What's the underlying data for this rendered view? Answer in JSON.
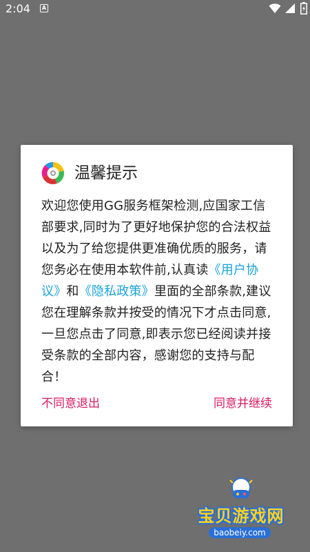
{
  "status_bar": {
    "time": "2:04",
    "notification_glyph": "A",
    "icons": [
      "wifi-icon",
      "signal-icon",
      "battery-icon"
    ]
  },
  "dialog": {
    "icon": "app-settings-icon",
    "title": "温馨提示",
    "body": {
      "part1": "欢迎您使用GG服务框架检测,应国家工信部要求,同时为了更好地保护您的合法权益以及为了给您提供更准确优质的服务，请您务必在使用本软件前,认真读",
      "link_user_agreement": "《用户协议》",
      "connector": "和",
      "link_privacy_policy": "《隐私政策》",
      "part2": "里面的全部条款,建议您在理解条款并按受的情况下才点击同意,一旦您点击了同意,即表示您已经阅读并接受条款的全部内容，感谢您的支持与配合！"
    },
    "decline_label": "不同意退出",
    "accept_label": "同意并继续"
  },
  "watermark": {
    "text": "宝贝游戏网",
    "url": "baobeiy.com"
  },
  "colors": {
    "overlay": "#6f6f6f",
    "link": "#1aa3d9",
    "button": "#d81b60"
  }
}
